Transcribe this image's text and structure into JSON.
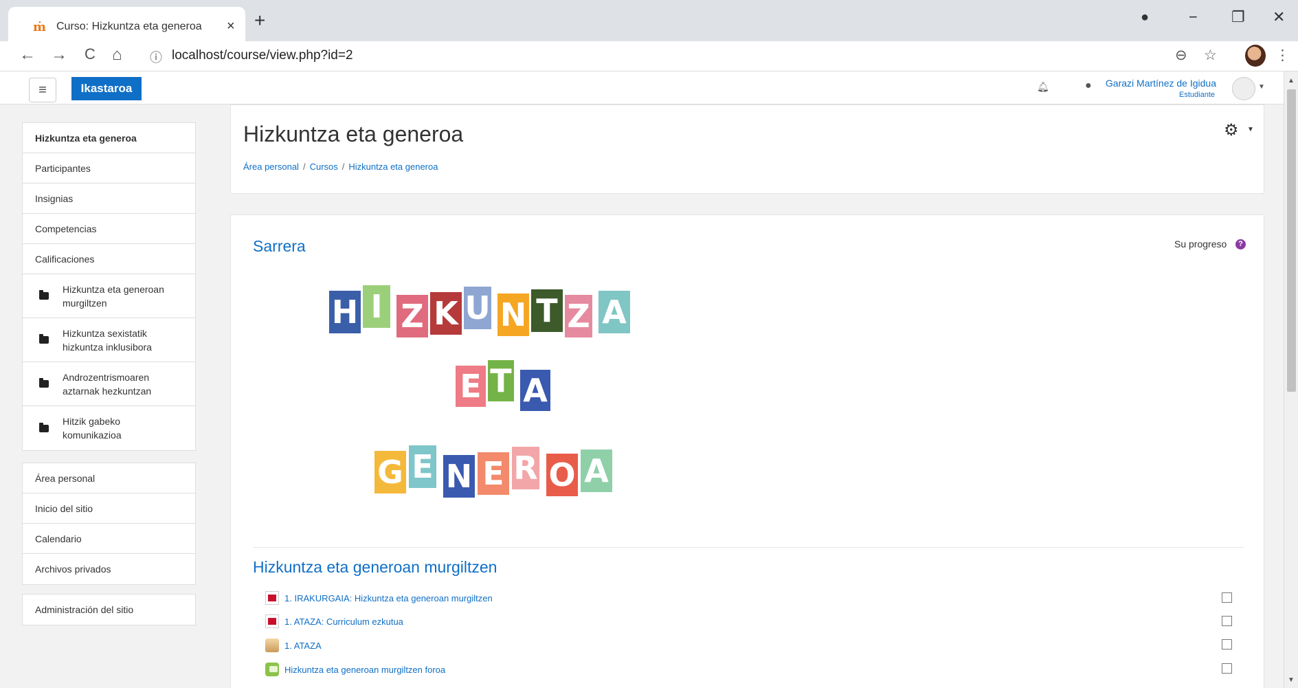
{
  "browser": {
    "tab_title": "Curso: Hizkuntza eta generoa",
    "tab_favicon": "moodle-icon",
    "url_info_icon": "ⓘ",
    "url": "localhost/course/view.php?id=2",
    "close_tab_glyph": "×",
    "new_tab_glyph": "+",
    "window_minimize": "−",
    "window_restore": "❐",
    "window_close": "✕",
    "back_glyph": "←",
    "forward_glyph": "→",
    "reload_glyph": "C",
    "home_glyph": "⌂",
    "zoom_glyph": "⊖",
    "star_glyph": "☆",
    "menu_glyph": "⋮"
  },
  "navbar": {
    "menu_glyph": "≡",
    "brand": "Ikastaroa",
    "user_name": "Garazi Martínez de Igidua",
    "user_role": "Estudiante"
  },
  "sidebar": {
    "course_nav": [
      {
        "label": "Hizkuntza eta generoa",
        "bold": true
      },
      {
        "label": "Participantes"
      },
      {
        "label": "Insignias"
      },
      {
        "label": "Competencias"
      },
      {
        "label": "Calificaciones"
      }
    ],
    "sections": [
      {
        "label": "Hizkuntza eta generoan murgiltzen"
      },
      {
        "label": "Hizkuntza sexistatik hizkuntza inklusibora"
      },
      {
        "label": "Androzentrismoaren aztarnak hezkuntzan"
      },
      {
        "label": "Hitzik gabeko komunikazioa"
      }
    ],
    "site_nav": [
      {
        "label": "Área personal"
      },
      {
        "label": "Inicio del sitio"
      },
      {
        "label": "Calendario"
      },
      {
        "label": "Archivos privados"
      }
    ],
    "admin": [
      {
        "label": "Administración del sitio"
      }
    ]
  },
  "header": {
    "title": "Hizkuntza eta generoa",
    "breadcrumb": [
      "Área personal",
      "Cursos",
      "Hizkuntza eta generoa"
    ],
    "breadcrumb_sep": "/",
    "gear_glyph": "⚙"
  },
  "main": {
    "intro_title": "Sarrera",
    "progress_label": "Su progreso",
    "help_glyph": "?",
    "banner": {
      "word1": [
        "H",
        "I",
        "Z",
        "K",
        "U",
        "N",
        "T",
        "Z",
        "A"
      ],
      "word2": [
        "E",
        "T",
        "A"
      ],
      "word3": [
        "G",
        "E",
        "N",
        "E",
        "R",
        "O",
        "A"
      ],
      "colors1": [
        "#3b5ea8",
        "#9ccf7a",
        "#e06b7e",
        "#b53a3a",
        "#8fa6d3",
        "#f5a623",
        "#3d5a2a",
        "#e68aa0",
        "#7fc6c4"
      ],
      "colors2": [
        "#ee7b85",
        "#74b347",
        "#3a5ab0"
      ],
      "colors3": [
        "#f4b93b",
        "#7fc6ca",
        "#3a5ab0",
        "#f28a6b",
        "#f2a6a8",
        "#e85d4a",
        "#8fd0a8"
      ]
    },
    "section_title": "Hizkuntza eta generoan murgiltzen",
    "activities": [
      {
        "label": "1. IRAKURGAIA: Hizkuntza eta generoan murgiltzen",
        "icon": "pdf-icon"
      },
      {
        "label": "1. ATAZA: Curriculum ezkutua",
        "icon": "pdf-icon"
      },
      {
        "label": "1. ATAZA",
        "icon": "assignment-icon"
      },
      {
        "label": "Hizkuntza eta generoan murgiltzen foroa",
        "icon": "forum-icon"
      }
    ]
  }
}
